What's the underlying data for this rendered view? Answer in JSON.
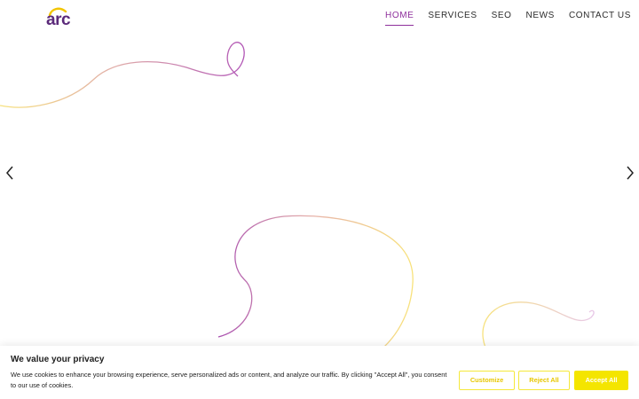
{
  "brand": {
    "logo_text": "arc",
    "logo_color": "#5b2a7a",
    "arc_color": "#f2c500"
  },
  "nav": {
    "items": [
      {
        "label": "HOME",
        "active": true
      },
      {
        "label": "SERVICES",
        "active": false
      },
      {
        "label": "SEO",
        "active": false
      },
      {
        "label": "NEWS",
        "active": false
      },
      {
        "label": "CONTACT US",
        "active": false
      }
    ],
    "active_color": "#8e2f9c"
  },
  "slider": {
    "prev_icon": "chevron-left-icon",
    "next_icon": "chevron-right-icon"
  },
  "cookie_banner": {
    "title": "We value your privacy",
    "text": "We use cookies to enhance your browsing experience, serve personalized ads or content, and analyze our traffic. By clicking \"Accept All\", you consent to our use of cookies.",
    "customize_label": "Customize",
    "reject_label": "Reject All",
    "accept_label": "Accept All",
    "accent_color": "#f4e500"
  },
  "decor": {
    "line_purple": "#b764b8",
    "line_yellow": "#f6de6c"
  }
}
